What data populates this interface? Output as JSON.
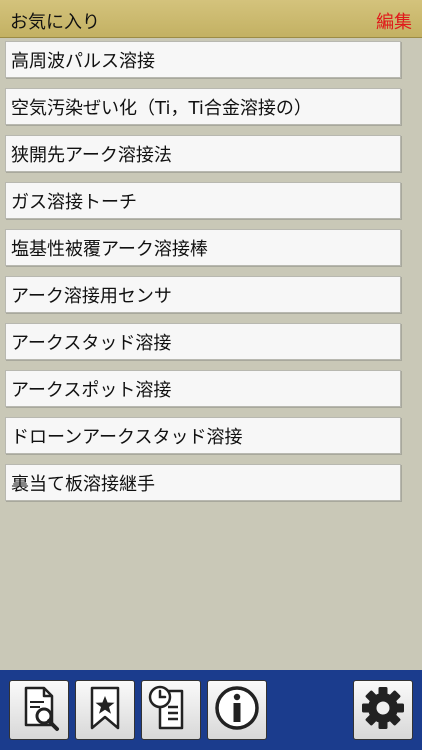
{
  "header": {
    "title": "お気に入り",
    "edit_label": "編集"
  },
  "favorites": [
    "高周波パルス溶接",
    "空気汚染ぜい化（Ti，Ti合金溶接の）",
    "狭開先アーク溶接法",
    "ガス溶接トーチ",
    "塩基性被覆アーク溶接棒",
    "アーク溶接用センサ",
    "アークスタッド溶接",
    "アークスポット溶接",
    "ドローンアークスタッド溶接",
    "裏当て板溶接継手"
  ],
  "toolbar": {
    "buttons": [
      {
        "icon": "document-search-icon"
      },
      {
        "icon": "bookmark-star-icon"
      },
      {
        "icon": "history-icon"
      },
      {
        "icon": "info-icon"
      },
      {
        "icon": "gear-icon"
      }
    ]
  },
  "colors": {
    "header_bg": "#c9b86c",
    "edit_text": "#e0191b",
    "background": "#c9c8b7",
    "toolbar_bg": "#1b3c8d"
  }
}
